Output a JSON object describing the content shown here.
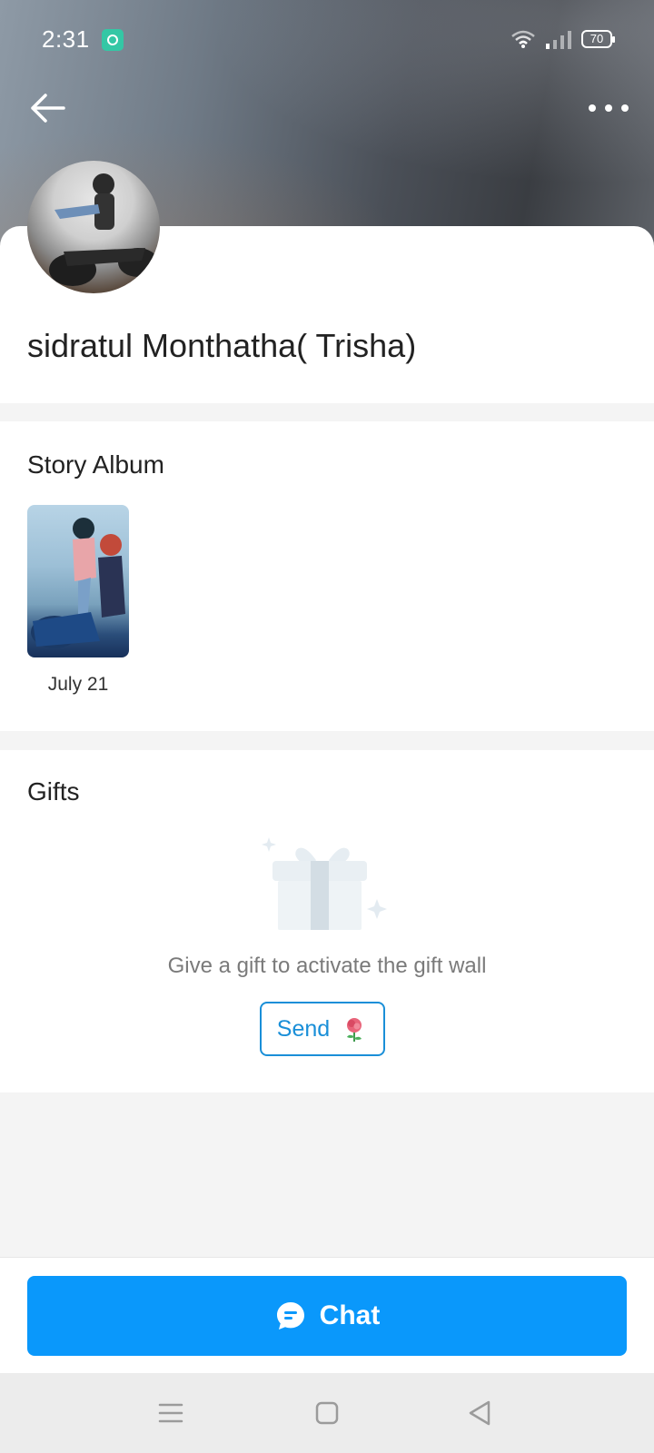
{
  "status_bar": {
    "time": "2:31",
    "battery": "70",
    "app_icon": "app-notification-icon"
  },
  "header": {
    "back_icon": "arrow-left-icon",
    "more_icon": "more-horizontal-icon"
  },
  "profile": {
    "name": "sidratul Monthatha( Trisha)"
  },
  "story_album": {
    "title": "Story Album",
    "items": [
      {
        "date": "July 21"
      }
    ]
  },
  "gifts": {
    "title": "Gifts",
    "hint": "Give a gift to activate the gift wall",
    "send_label": "Send",
    "send_icon": "rose-icon"
  },
  "bottom": {
    "chat_label": "Chat",
    "chat_icon": "chat-bubble-icon"
  },
  "colors": {
    "accent": "#0a98fb",
    "send_border": "#1a8fd8"
  }
}
